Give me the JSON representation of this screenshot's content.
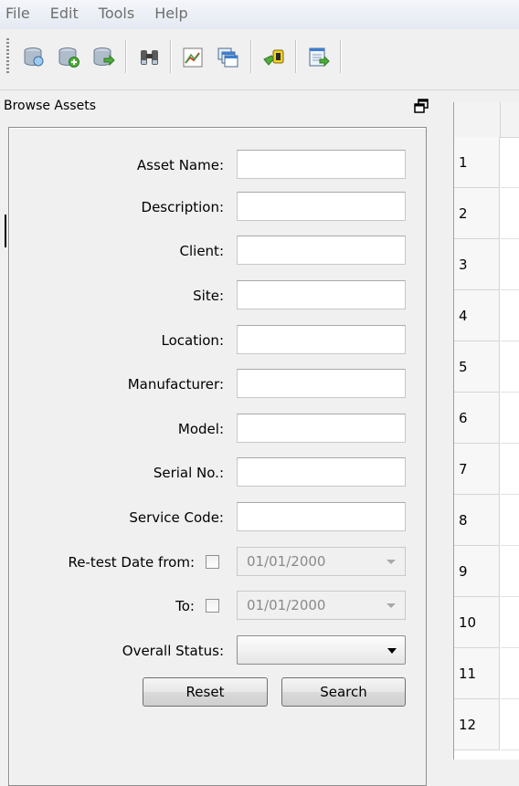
{
  "menu": [
    "File",
    "Edit",
    "Tools",
    "Help"
  ],
  "toolbar": {
    "icons": [
      "database-browse-icon",
      "database-add-icon",
      "database-export-icon",
      "binoculars-icon",
      "report-chart-icon",
      "windows-cascade-icon",
      "key-icon",
      "export-sheet-icon"
    ]
  },
  "dock": {
    "title": "Browse Assets"
  },
  "form": {
    "asset_name": {
      "label": "Asset Name:",
      "value": ""
    },
    "description": {
      "label": "Description:",
      "value": ""
    },
    "client": {
      "label": "Client:",
      "value": ""
    },
    "site": {
      "label": "Site:",
      "value": ""
    },
    "location": {
      "label": "Location:",
      "value": ""
    },
    "manufacturer": {
      "label": "Manufacturer:",
      "value": ""
    },
    "model": {
      "label": "Model:",
      "value": ""
    },
    "serial": {
      "label": "Serial No.:",
      "value": ""
    },
    "service_code": {
      "label": "Service Code:",
      "value": ""
    },
    "retest_from": {
      "label": "Re-test Date from:",
      "checked": false,
      "value": "01/01/2000"
    },
    "retest_to": {
      "label": "To:",
      "checked": false,
      "value": "01/01/2000"
    },
    "overall_status": {
      "label": "Overall Status:",
      "value": ""
    },
    "reset_label": "Reset",
    "search_label": "Search"
  },
  "grid": {
    "row_numbers": [
      "1",
      "2",
      "3",
      "4",
      "5",
      "6",
      "7",
      "8",
      "9",
      "10",
      "11",
      "12"
    ]
  }
}
